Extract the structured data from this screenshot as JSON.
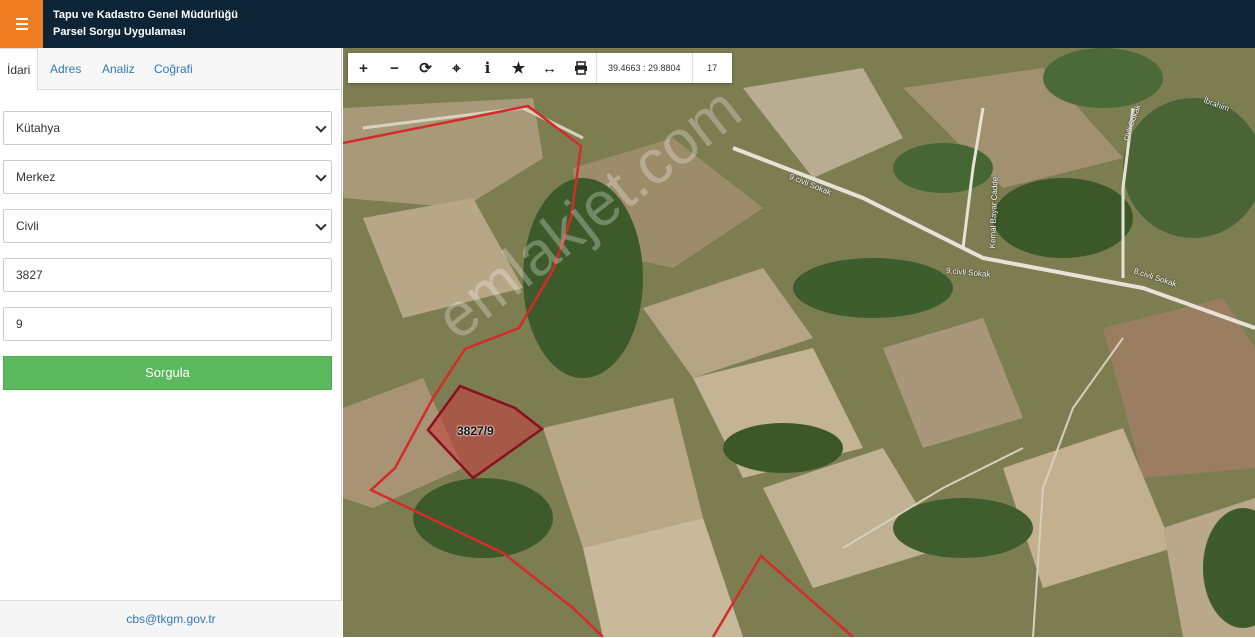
{
  "header": {
    "title_line1": "Tapu ve Kadastro Genel Müdürlüğü",
    "title_line2": "Parsel Sorgu Uygulaması",
    "menu_icon": "hamburger-icon",
    "accent_color": "#f07d22",
    "bar_color": "#0d2436"
  },
  "tabs": [
    {
      "label": "İdari",
      "active": true
    },
    {
      "label": "Adres",
      "active": false
    },
    {
      "label": "Analiz",
      "active": false
    },
    {
      "label": "Coğrafi",
      "active": false
    }
  ],
  "form": {
    "il": "Kütahya",
    "ilce": "Merkez",
    "mahalle": "Civli",
    "ada": "3827",
    "parsel": "9",
    "submit_label": "Sorgula"
  },
  "footer": {
    "email": "cbs@tkgm.gov.tr"
  },
  "map": {
    "coords": "39.4663 : 29.8804",
    "zoom": "17",
    "parcel_label": "3827/9",
    "watermark": "emlakjet.com",
    "streets": [
      "9.civli Sokak",
      "Kemal Bayar Cadde",
      "9.civli Sokak",
      "8.civli Sokak",
      "İbrahim",
      "civli Sokak"
    ]
  },
  "toolbar_icons": [
    "plus-icon",
    "minus-icon",
    "refresh-icon",
    "crosshair-icon",
    "info-icon",
    "star-icon",
    "measure-icon",
    "print-icon"
  ]
}
